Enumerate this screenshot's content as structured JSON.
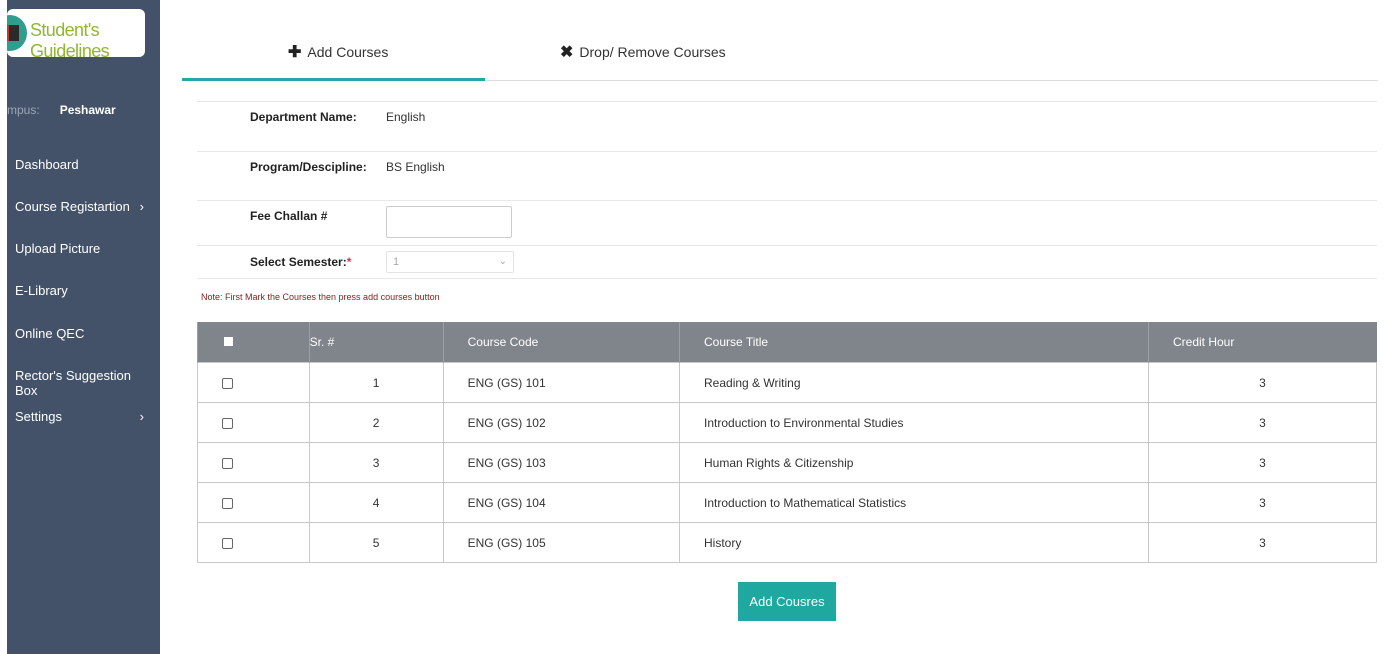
{
  "sidebar": {
    "logo_text": "Student's Guidelines",
    "campus_label": "mpus:",
    "campus_value": "Peshawar",
    "items": [
      {
        "label": "Dashboard",
        "chevron": ""
      },
      {
        "label": "Course Registartion",
        "chevron": "›"
      },
      {
        "label": "Upload Picture",
        "chevron": ""
      },
      {
        "label": "E-Library",
        "chevron": ""
      },
      {
        "label": "Online QEC",
        "chevron": ""
      },
      {
        "label": "Rector's Suggestion Box",
        "chevron": ""
      },
      {
        "label": "Settings",
        "chevron": "›"
      }
    ]
  },
  "tabs": [
    {
      "icon": "✚",
      "label": "Add Courses"
    },
    {
      "icon": "✖",
      "label": "Drop/ Remove Courses"
    }
  ],
  "form": {
    "department_label": "Department Name:",
    "department_value": "English",
    "program_label": "Program/Descipline:",
    "program_value": "BS English",
    "fee_label": "Fee Challan #",
    "fee_value": "",
    "semester_label": "Select Semester:",
    "semester_required": "*",
    "semester_value": "1",
    "note": "Note: First Mark the Courses then press add courses button"
  },
  "table": {
    "headers": [
      "Sr. #",
      "Course Code",
      "Course Title",
      "Credit Hour"
    ],
    "rows": [
      {
        "sr": "1",
        "code": "ENG (GS) 101",
        "title": "Reading & Writing",
        "hours": "3"
      },
      {
        "sr": "2",
        "code": "ENG (GS) 102",
        "title": "Introduction to Environmental Studies",
        "hours": "3"
      },
      {
        "sr": "3",
        "code": "ENG (GS) 103",
        "title": "Human Rights & Citizenship",
        "hours": "3"
      },
      {
        "sr": "4",
        "code": "ENG (GS) 104",
        "title": "Introduction to Mathematical Statistics",
        "hours": "3"
      },
      {
        "sr": "5",
        "code": "ENG (GS) 105",
        "title": "History",
        "hours": "3"
      }
    ]
  },
  "add_button_label": "Add Cousres",
  "colors": {
    "sidebar_bg": "#445269",
    "accent": "#1fa8a0",
    "table_header": "#7f858b",
    "logo_text": "#8fb82c"
  }
}
